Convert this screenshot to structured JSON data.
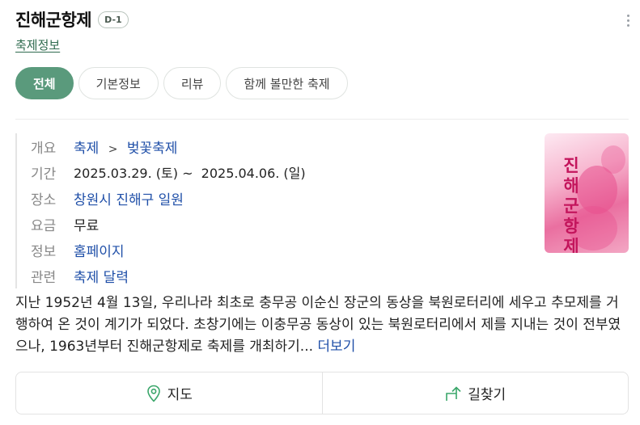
{
  "header": {
    "title": "진해군항제",
    "dday": "D-1",
    "category": "축제정보"
  },
  "tabs": [
    {
      "label": "전체",
      "active": true
    },
    {
      "label": "기본정보",
      "active": false
    },
    {
      "label": "리뷰",
      "active": false
    },
    {
      "label": "함께 볼만한 축제",
      "active": false
    }
  ],
  "info": {
    "overview_key": "개요",
    "overview_cat1": "축제",
    "overview_sep": ">",
    "overview_cat2": "벚꽃축제",
    "period_key": "기간",
    "period_val": "2025.03.29. (토) ~  2025.04.06. (일)",
    "place_key": "장소",
    "place_val": "창원시 진해구 일원",
    "fee_key": "요금",
    "fee_val": "무료",
    "web_key": "정보",
    "web_val": "홈페이지",
    "related_key": "관련",
    "related_val": "축제 달력"
  },
  "poster": {
    "text": "진해 군항제"
  },
  "description": {
    "text": "지난 1952년 4월 13일, 우리나라 최초로 충무공 이순신 장군의 동상을 북원로터리에 세우고 추모제를 거행하여 온 것이 계기가 되었다. 초창기에는 이충무공 동상이 있는 북원로터리에서 제를 지내는 것이 전부였으나, 1963년부터 진해군항제로 축제를 개최하기...",
    "more": " 더보기"
  },
  "actions": {
    "map": "지도",
    "route": "길찾기"
  },
  "colors": {
    "accent": "#5a9a7c",
    "link": "#1f4fa8",
    "category": "#2f6b4f"
  }
}
